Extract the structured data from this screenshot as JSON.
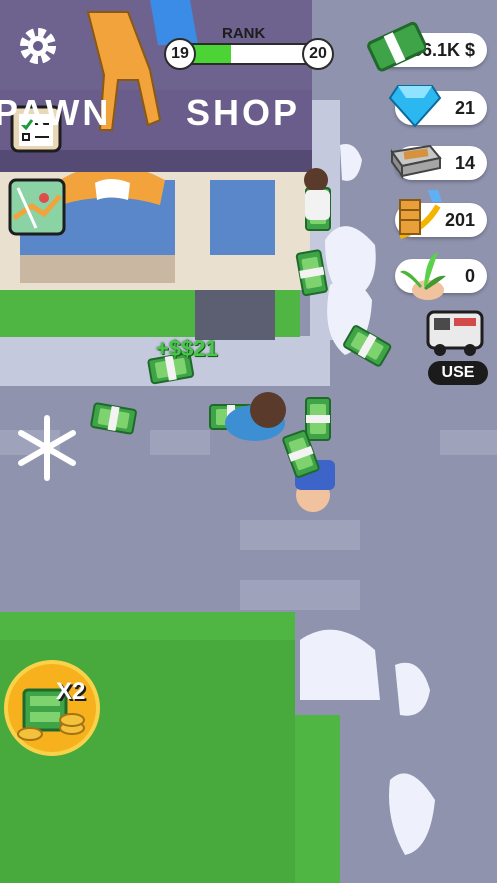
{
  "rank": {
    "label": "RANK",
    "current_level": "19",
    "next_level": "20",
    "progress": 0.35
  },
  "resources": {
    "cash": "136.1K $",
    "gems": "21",
    "bricks": "14",
    "furniture": "201",
    "plants": "0"
  },
  "vehicle": {
    "use_label": "USE"
  },
  "shop_sign": {
    "left_text": "PAWN",
    "right_text": "SHOP"
  },
  "floating_reward": "+$$21",
  "boost": {
    "multiplier_label": "X2"
  },
  "colors": {
    "progress_green": "#4cd436",
    "shop_roof": "#6a5d8c",
    "grass": "#4fb543",
    "street": "#8f93ad"
  }
}
